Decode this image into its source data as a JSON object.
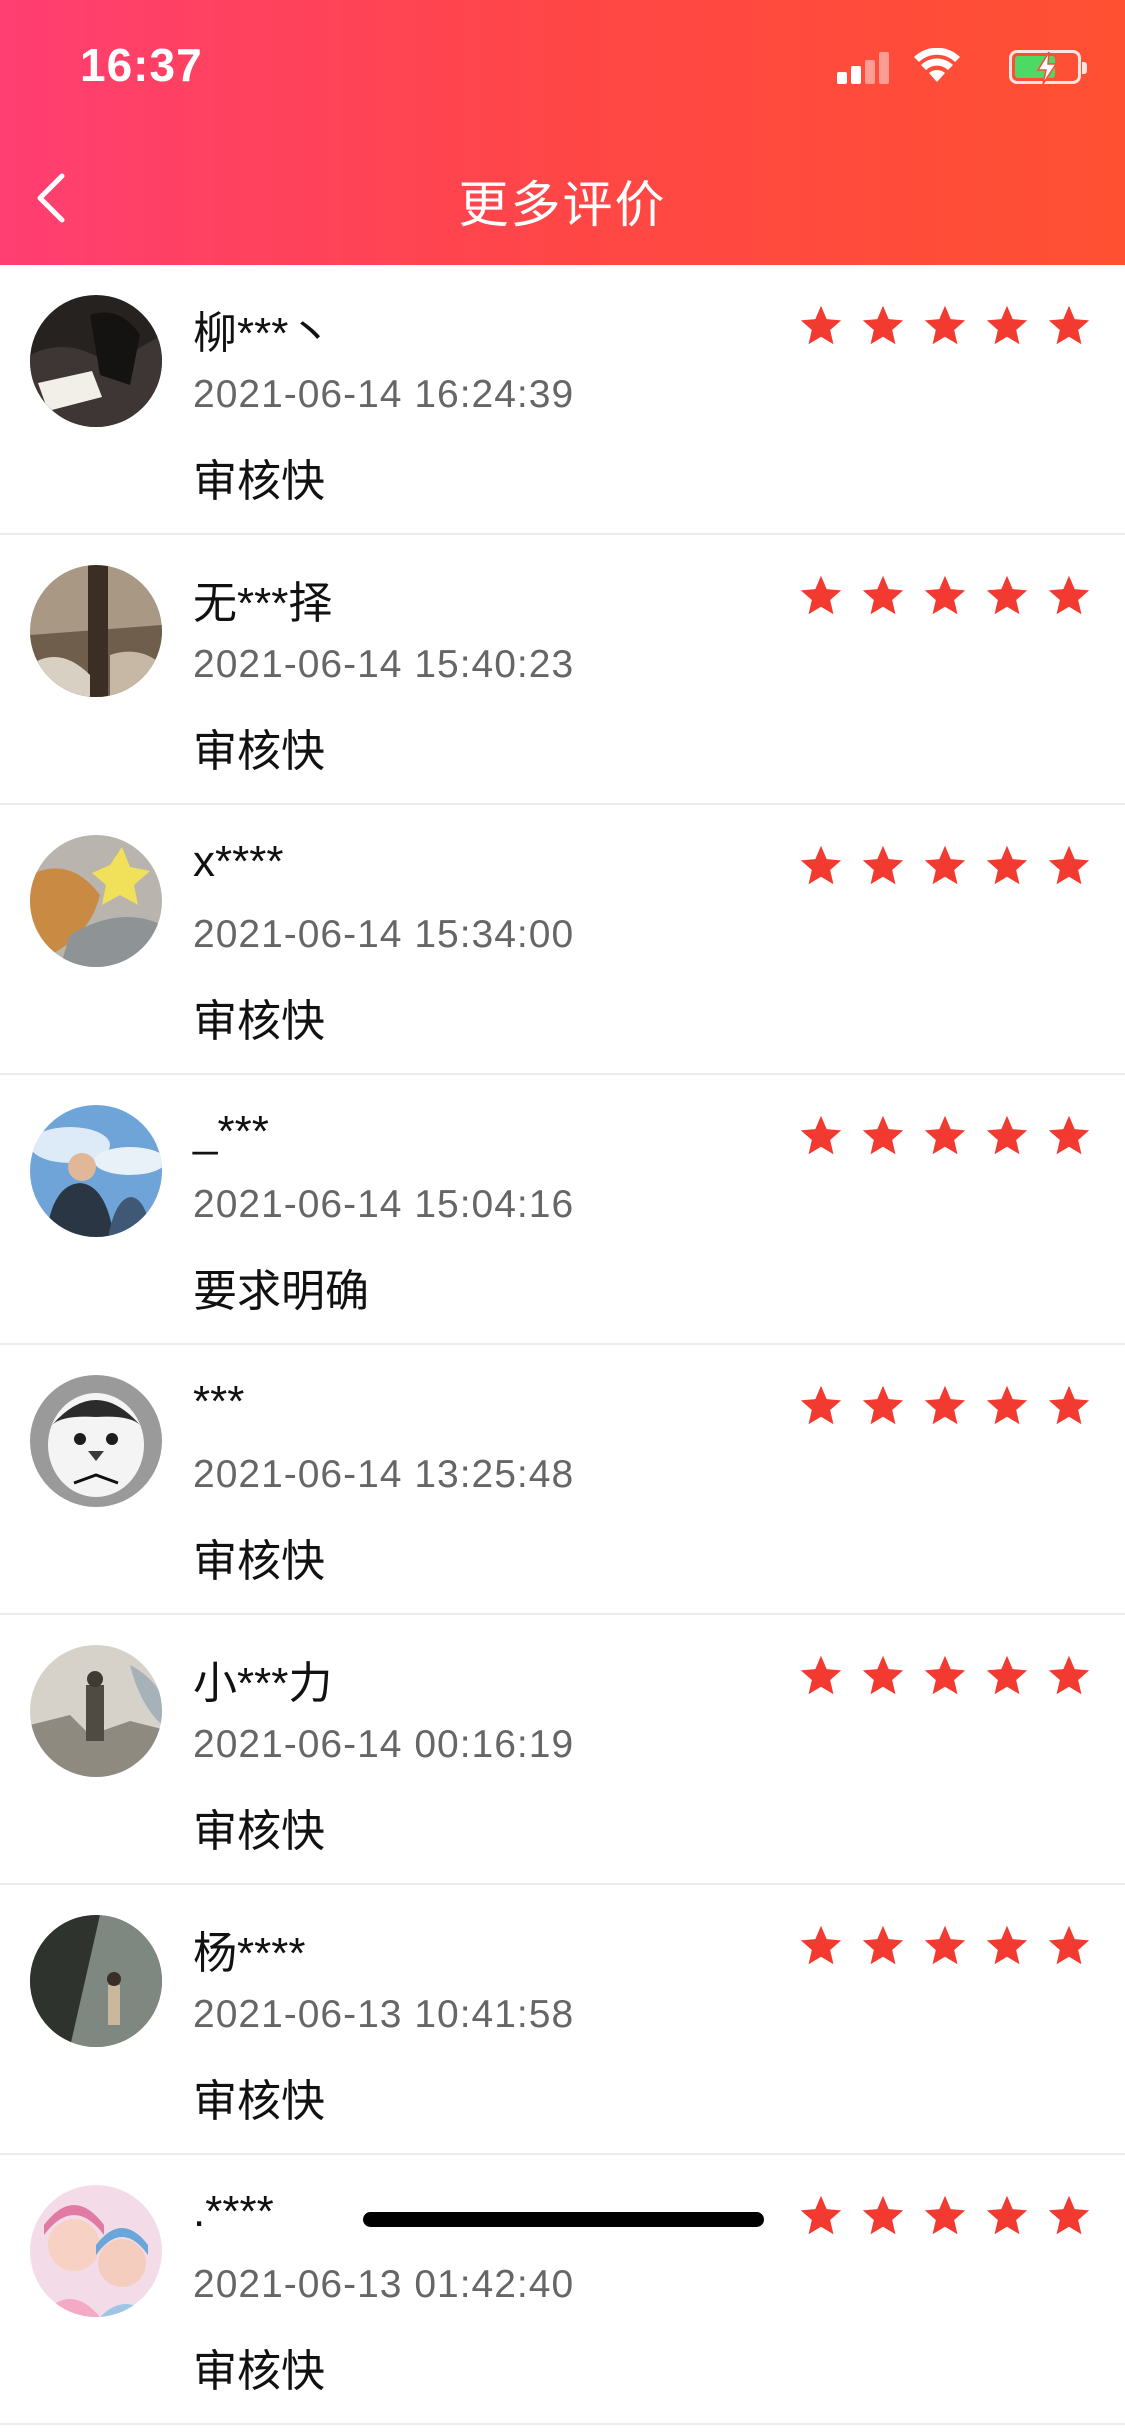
{
  "status_bar": {
    "time": "16:37"
  },
  "header": {
    "title": "更多评价"
  },
  "colors": {
    "accent": "#ff4646",
    "star": "#f23a30"
  },
  "reviews": [
    {
      "name": "柳***丶",
      "time": "2021-06-14 16:24:39",
      "comment": "审核快",
      "rating": 5
    },
    {
      "name": "无***择",
      "time": "2021-06-14 15:40:23",
      "comment": "审核快",
      "rating": 5
    },
    {
      "name": "x****",
      "time": "2021-06-14 15:34:00",
      "comment": "审核快",
      "rating": 5
    },
    {
      "name": "_***",
      "time": "2021-06-14 15:04:16",
      "comment": "要求明确",
      "rating": 5
    },
    {
      "name": "***",
      "time": "2021-06-14 13:25:48",
      "comment": "审核快",
      "rating": 5
    },
    {
      "name": "小***力",
      "time": "2021-06-14 00:16:19",
      "comment": "审核快",
      "rating": 5
    },
    {
      "name": "杨****",
      "time": "2021-06-13 10:41:58",
      "comment": "审核快",
      "rating": 5
    },
    {
      "name": ".****",
      "time": "2021-06-13 01:42:40",
      "comment": "审核快",
      "rating": 5
    }
  ]
}
